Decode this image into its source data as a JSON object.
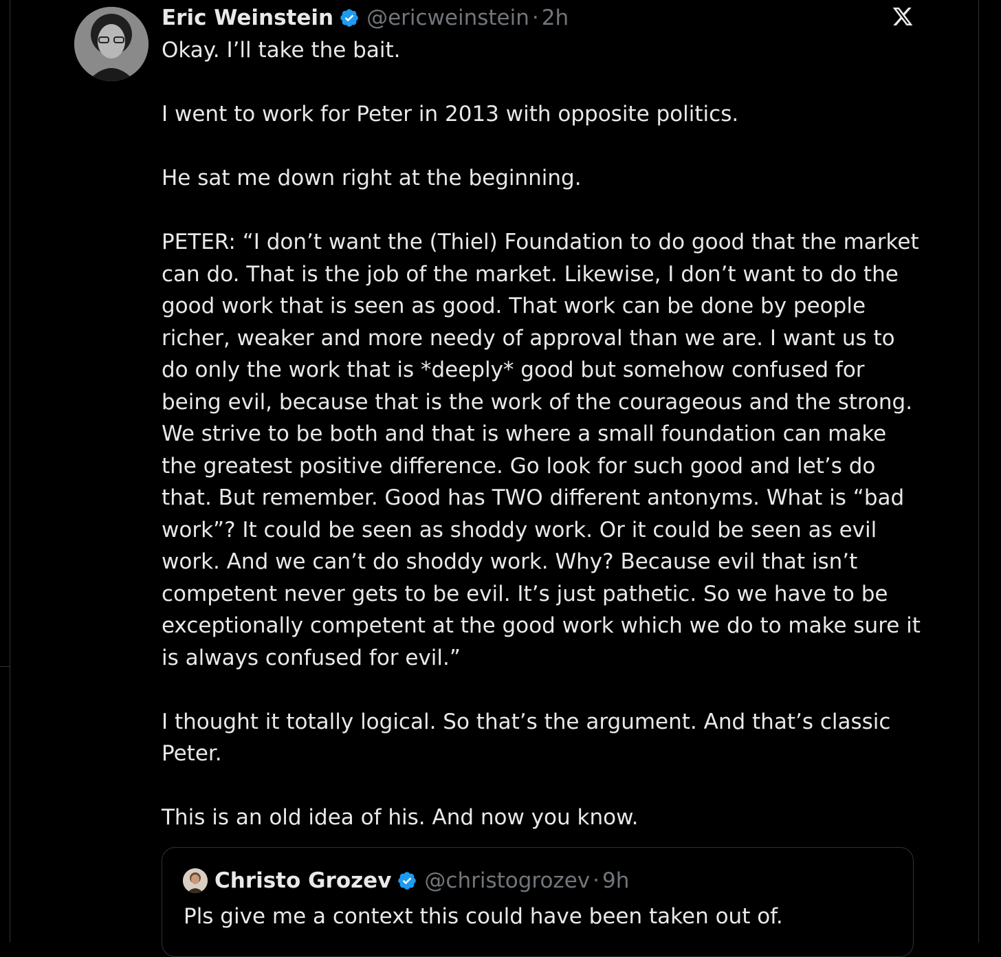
{
  "tweet": {
    "author_name": "Eric Weinstein",
    "handle": "@ericweinstein",
    "separator": "·",
    "time": "2h",
    "paragraphs": [
      "Okay. I’ll take the bait.",
      "I went to work for Peter in 2013 with opposite politics.",
      "He sat me down right at the beginning.",
      "PETER: “I don’t want the (Thiel) Foundation to do good that the market can do. That is the job of the market. Likewise, I don’t want to do the good work that is seen as good. That work can be done by people richer, weaker and more needy of approval than we are. I want us to do only the work that is *deeply* good but somehow confused for being evil, because that is the work of the courageous and the strong. We strive to be both and that is where a small foundation can make the greatest positive difference. Go look for such good and let’s do that. But remember. Good has TWO different  antonyms. What is “bad work”? It could be seen as shoddy work. Or it could be seen as evil work. And we can’t do shoddy work. Why? Because evil that isn’t competent never gets to be evil. It’s just pathetic. So we have to be exceptionally competent at the good work which we do to make sure it is always confused for evil.”",
      "I thought it totally logical. So that’s the argument. And that’s classic Peter.",
      "This is an old idea of his. And now you know."
    ]
  },
  "quoted_tweet": {
    "author_name": "Christo Grozev",
    "handle": "@christogrozev",
    "separator": "·",
    "time": "9h",
    "text": "Pls give me a context this could have been taken out of."
  },
  "colors": {
    "background": "#000000",
    "text_primary": "#e7e9ea",
    "text_secondary": "#71767b",
    "verified_blue": "#1d9bf0",
    "border": "#2f3336"
  },
  "icons": {
    "verified": "verified-badge-icon",
    "platform": "x-logo-icon"
  }
}
